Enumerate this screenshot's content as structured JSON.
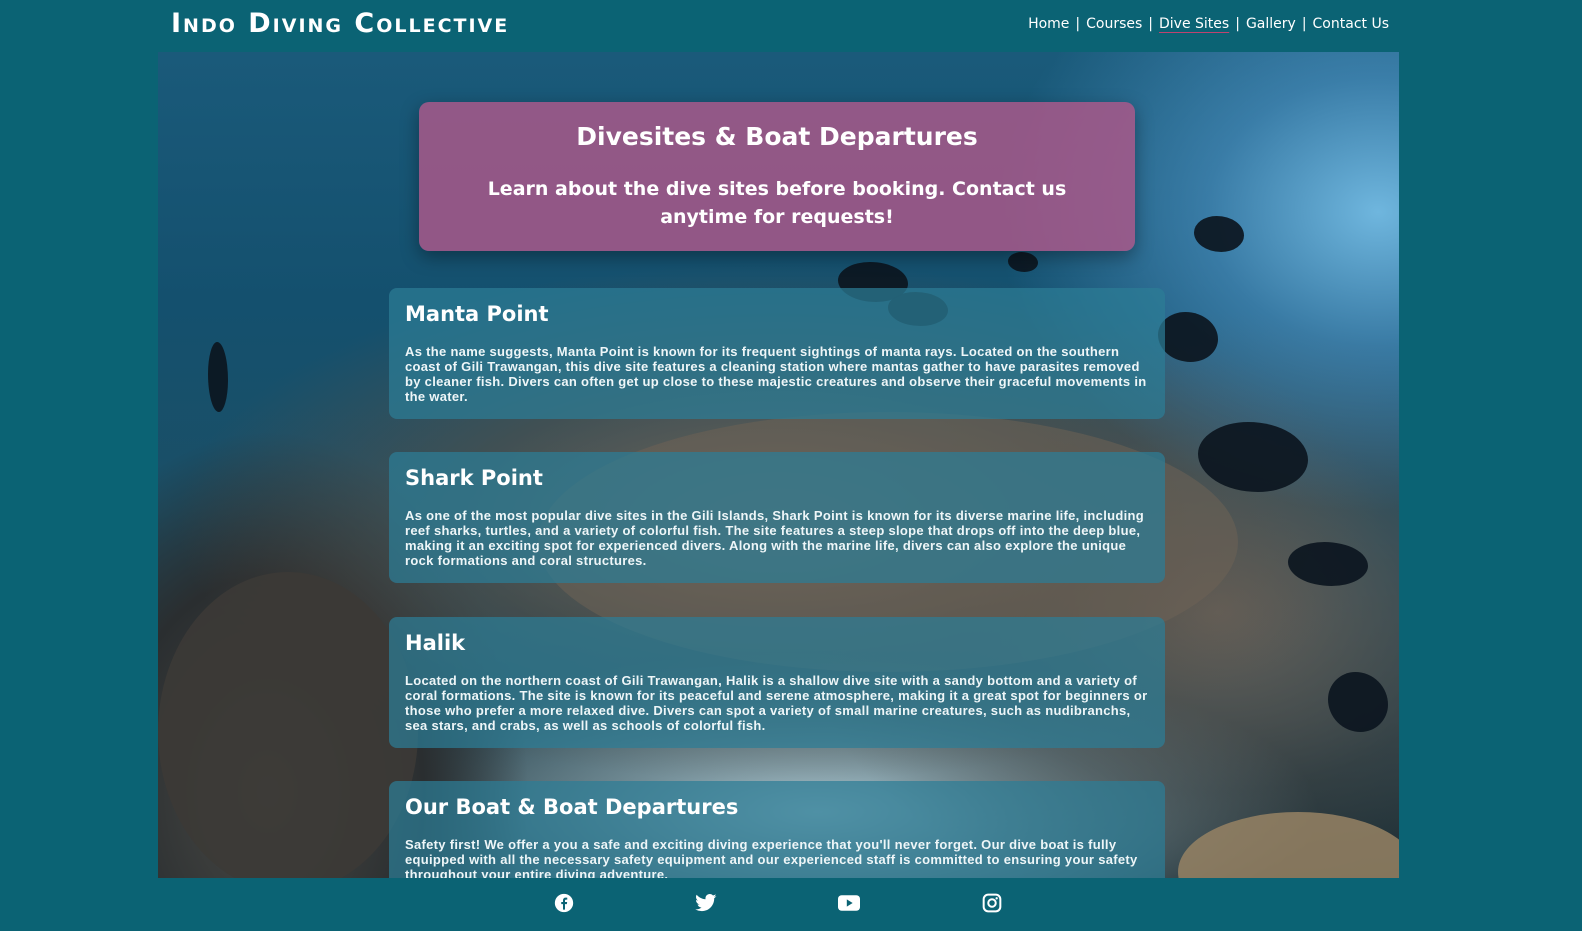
{
  "brand": {
    "title": "Indo Diving Collective"
  },
  "nav": {
    "items": [
      {
        "label": "Home"
      },
      {
        "label": "Courses"
      },
      {
        "label": "Dive Sites",
        "active": true
      },
      {
        "label": "Gallery"
      },
      {
        "label": "Contact Us"
      }
    ],
    "separator": "|"
  },
  "banner": {
    "title": "Divesites & Boat Departures",
    "subtitle": "Learn about the dive sites before booking. Contact us anytime for requests!"
  },
  "sites": [
    {
      "title": "Manta Point",
      "text": "As the name suggests, Manta Point is known for its frequent sightings of manta rays. Located on the southern coast of Gili Trawangan, this dive site features a cleaning station where mantas gather to have parasites removed by cleaner fish. Divers can often get up close to these majestic creatures and observe their graceful movements in the water."
    },
    {
      "title": "Shark Point",
      "text": "As one of the most popular dive sites in the Gili Islands, Shark Point is known for its diverse marine life, including reef sharks, turtles, and a variety of colorful fish. The site features a steep slope that drops off into the deep blue, making it an exciting spot for experienced divers. Along with the marine life, divers can also explore the unique rock formations and coral structures."
    },
    {
      "title": "Halik",
      "text": "Located on the northern coast of Gili Trawangan, Halik is a shallow dive site with a sandy bottom and a variety of coral formations. The site is known for its peaceful and serene atmosphere, making it a great spot for beginners or those who prefer a more relaxed dive. Divers can spot a variety of small marine creatures, such as nudibranchs, sea stars, and crabs, as well as schools of colorful fish."
    },
    {
      "title": "Our Boat & Boat Departures",
      "text": "Safety first! We offer a you a safe and exciting diving experience that you'll never forget. Our dive boat is fully equipped with all the necessary safety equipment and our experienced staff is committed to ensuring your safety throughout your entire diving adventure."
    }
  ],
  "footer": {
    "social": [
      "facebook-icon",
      "twitter-icon",
      "youtube-icon",
      "instagram-icon"
    ]
  },
  "colors": {
    "page_bg": "#0b6374",
    "banner_bg": "#a8588a",
    "card_bg": "#2d7d96",
    "nav_active_underline": "#c0436f"
  }
}
